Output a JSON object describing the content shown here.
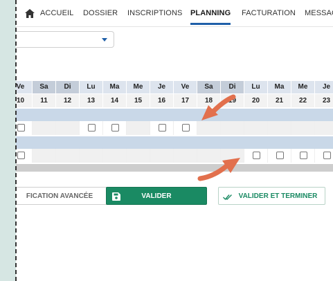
{
  "nav": {
    "items": [
      "ACCUEIL",
      "DOSSIER",
      "INSCRIPTIONS",
      "PLANNING",
      "FACTURATION",
      "MESSAG"
    ],
    "active": "PLANNING"
  },
  "planning": {
    "days": [
      "Ve",
      "Sa",
      "Di",
      "Lu",
      "Ma",
      "Me",
      "Je",
      "Ve",
      "Sa",
      "Di",
      "Lu",
      "Ma",
      "Me",
      "Je"
    ],
    "numbers": [
      "10",
      "11",
      "12",
      "13",
      "14",
      "15",
      "16",
      "17",
      "18",
      "19",
      "20",
      "21",
      "22",
      "23"
    ],
    "row1_checkboxes": [
      true,
      false,
      false,
      true,
      true,
      false,
      true,
      true,
      false,
      false,
      false,
      false,
      false,
      false
    ],
    "row2_checkboxes": [
      true,
      false,
      false,
      false,
      false,
      false,
      false,
      false,
      false,
      false,
      true,
      true,
      true,
      true
    ]
  },
  "buttons": {
    "advanced_label": "FICATION AVANCÉE",
    "validate_label": "VALIDER",
    "validate_finish_label": "VALIDER ET TERMINER"
  },
  "colors": {
    "accent": "#1f5fa8",
    "validate_green": "#1a8a63",
    "arrow": "#e2704d"
  }
}
